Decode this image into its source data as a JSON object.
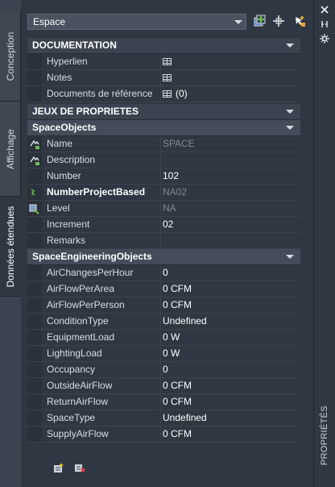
{
  "left_tabs": [
    "Conception",
    "Affichage",
    "Données étendues"
  ],
  "active_tab": "Données étendues",
  "header": {
    "object_type": "Espace"
  },
  "sections": {
    "documentation": {
      "title": "DOCUMENTATION",
      "rows": [
        {
          "name": "Hyperlien",
          "value": ""
        },
        {
          "name": "Notes",
          "value": ""
        },
        {
          "name": "Documents de référence",
          "value": "(0)"
        }
      ]
    },
    "property_sets": {
      "title": "JEUX DE PROPRIETES"
    },
    "space_objects": {
      "title": "SpaceObjects",
      "rows": [
        {
          "name": "Name",
          "value": "SPACE"
        },
        {
          "name": "Description",
          "value": ""
        },
        {
          "name": "Number",
          "value": "102"
        },
        {
          "name": "NumberProjectBased",
          "value": "NA02"
        },
        {
          "name": "Level",
          "value": "NA"
        },
        {
          "name": "Increment",
          "value": "02"
        },
        {
          "name": "Remarks",
          "value": ""
        }
      ]
    },
    "space_engineering": {
      "title": "SpaceEngineeringObjects",
      "rows": [
        {
          "name": "AirChangesPerHour",
          "value": "0"
        },
        {
          "name": "AirFlowPerArea",
          "value": "0 CFM"
        },
        {
          "name": "AirFlowPerPerson",
          "value": "0 CFM"
        },
        {
          "name": "ConditionType",
          "value": "Undefined"
        },
        {
          "name": "EquipmentLoad",
          "value": "0 W"
        },
        {
          "name": "LightingLoad",
          "value": "0 W"
        },
        {
          "name": "Occupancy",
          "value": "0"
        },
        {
          "name": "OutsideAirFlow",
          "value": "0 CFM"
        },
        {
          "name": "ReturnAirFlow",
          "value": "0 CFM"
        },
        {
          "name": "SpaceType",
          "value": "Undefined"
        },
        {
          "name": "SupplyAirFlow",
          "value": "0 CFM"
        }
      ]
    }
  },
  "right_strip": {
    "label": "PROPRIÉTÉS"
  },
  "colors": {
    "panel_bg": "#2f3742",
    "header_bg": "#3b4350",
    "accent_green": "#6cc04a"
  }
}
